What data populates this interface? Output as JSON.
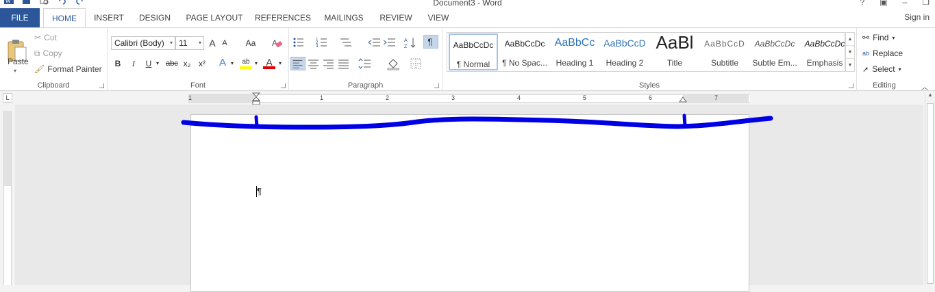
{
  "window": {
    "title": "Document3 - Word",
    "controls": [
      "?",
      "▣",
      "–",
      "❐"
    ]
  },
  "tabs": [
    "FILE",
    "HOME",
    "INSERT",
    "DESIGN",
    "PAGE LAYOUT",
    "REFERENCES",
    "MAILINGS",
    "REVIEW",
    "VIEW"
  ],
  "active_tab": "HOME",
  "sign_in": "Sign in",
  "clipboard": {
    "label": "Clipboard",
    "paste": "Paste",
    "cut": "Cut",
    "copy": "Copy",
    "format_painter": "Format Painter"
  },
  "font": {
    "label": "Font",
    "font_name": "Calibri (Body)",
    "font_size": "11",
    "grow": "A",
    "shrink": "A",
    "change_case": "Aa",
    "bold": "B",
    "italic": "I",
    "underline": "U",
    "strikethrough": "abc",
    "subscript": "x₂",
    "superscript": "x²",
    "text_effects": "A",
    "highlight": "ab",
    "font_color": "A",
    "highlight_color": "#ffff00",
    "font_color_value": "#e00000"
  },
  "paragraph": {
    "label": "Paragraph"
  },
  "styles": {
    "label": "Styles",
    "items": [
      {
        "sample": "AaBbCcDc",
        "name": "¶ Normal",
        "selected": true
      },
      {
        "sample": "AaBbCcDc",
        "name": "¶ No Spac..."
      },
      {
        "sample": "AaBbCc",
        "name": "Heading 1"
      },
      {
        "sample": "AaBbCcD",
        "name": "Heading 2"
      },
      {
        "sample": "AaBl",
        "name": "Title"
      },
      {
        "sample": "AaBbCcD",
        "name": "Subtitle"
      },
      {
        "sample": "AaBbCcDc",
        "name": "Subtle Em..."
      },
      {
        "sample": "AaBbCcDc",
        "name": "Emphasis"
      }
    ]
  },
  "editing": {
    "label": "Editing",
    "find": "Find",
    "replace": "Replace",
    "select": "Select"
  },
  "ruler": {
    "numbers": [
      "1",
      "1",
      "2",
      "3",
      "4",
      "5",
      "6",
      "7"
    ],
    "tab_selector": "L"
  },
  "document": {
    "pilcrow": "¶"
  },
  "annotation_color": "#0000e6"
}
